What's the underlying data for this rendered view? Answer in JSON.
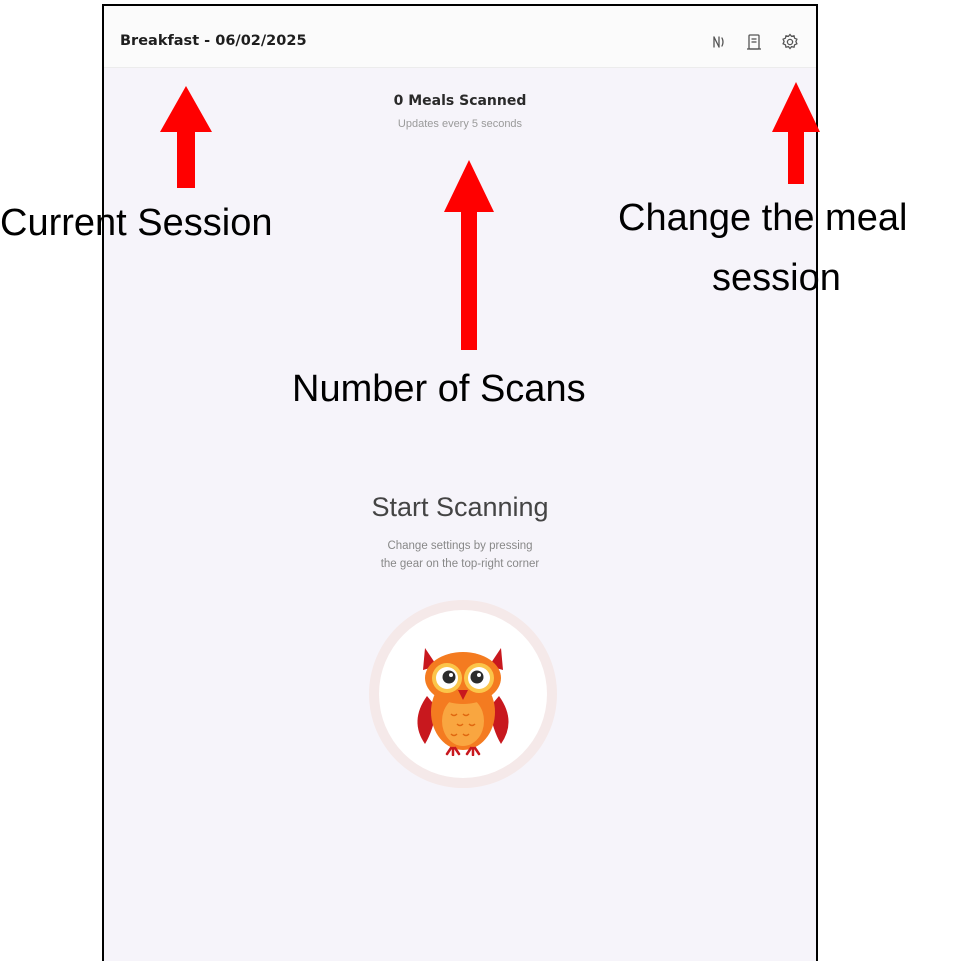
{
  "topbar": {
    "session_title": "Breakfast - 06/02/2025",
    "icons": [
      "nfc-icon",
      "receipt-icon",
      "gear-icon"
    ]
  },
  "scan_status": {
    "count_label": "0 Meals Scanned",
    "subtitle": "Updates every 5 seconds"
  },
  "empty_state": {
    "title": "Start Scanning",
    "hint_line1": "Change settings by pressing",
    "hint_line2": "the gear on the top-right corner",
    "illustration": "owl-mascot"
  },
  "annotations": {
    "current_session": "Current Session",
    "change_session_line1": "Change the meal",
    "change_session_line2": "session",
    "number_of_scans": "Number of Scans"
  },
  "colors": {
    "arrow": "#ff0000",
    "background": "#f6f4fa",
    "owl_body": "#f47b20",
    "owl_wing": "#c8181e"
  }
}
